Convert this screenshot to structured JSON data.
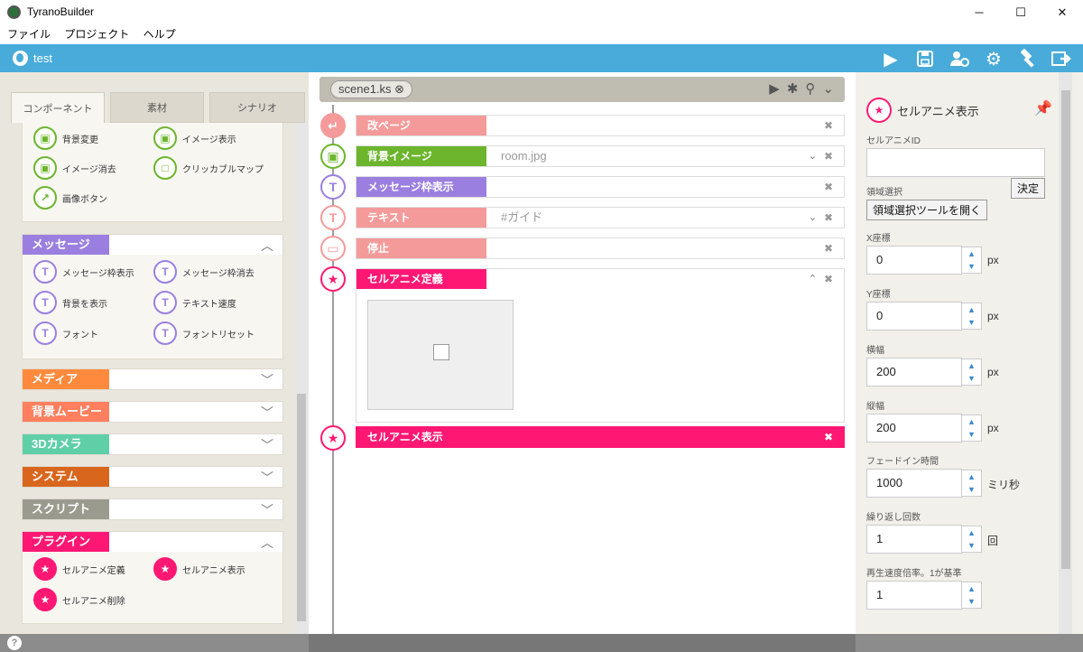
{
  "window": {
    "title": "TyranoBuilder",
    "minimize": "─",
    "maximize": "☐",
    "close": "✕"
  },
  "menu": [
    "ファイル",
    "プロジェクト",
    "ヘルプ"
  ],
  "topbar": {
    "project": "test"
  },
  "left_tabs": [
    "コンポーネント",
    "素材",
    "シナリオ"
  ],
  "image_components": [
    "背景変更",
    "イメージ表示",
    "イメージ消去",
    "クリッカブルマップ",
    "画像ボタン"
  ],
  "categories": {
    "message": "メッセージ",
    "media": "メディア",
    "bgmovie": "背景ムービー",
    "camera": "3Dカメラ",
    "system": "システム",
    "script": "スクリプト",
    "plugin": "プラグイン"
  },
  "colors": {
    "message": "#9b7fe0",
    "media": "#ff8a3d",
    "bgmovie": "#ff7f5f",
    "camera": "#5fcfa8",
    "system": "#d9661d",
    "script": "#9a9a8e",
    "plugin": "#ff1873",
    "green": "#6cb52d",
    "salmon": "#f59a9a"
  },
  "message_components": [
    "メッセージ枠表示",
    "メッセージ枠消去",
    "背景を表示",
    "テキスト速度",
    "フォント",
    "フォントリセット"
  ],
  "plugin_components": [
    "セルアニメ定義",
    "セルアニメ表示",
    "セルアニメ削除"
  ],
  "scene": {
    "tab": "scene1.ks"
  },
  "timeline": [
    {
      "label": "改ページ",
      "value": ""
    },
    {
      "label": "背景イメージ",
      "value": "room.jpg"
    },
    {
      "label": "メッセージ枠表示",
      "value": ""
    },
    {
      "label": "テキスト",
      "value": "#ガイド"
    },
    {
      "label": "停止",
      "value": ""
    },
    {
      "label": "セルアニメ定義",
      "value": ""
    },
    {
      "label": "セルアニメ表示",
      "value": ""
    }
  ],
  "props": {
    "title": "セルアニメ表示",
    "id_label": "セルアニメID",
    "id_value": "",
    "decide": "決定",
    "region_label": "領域選択",
    "region_button": "領域選択ツールを開く",
    "x_label": "X座標",
    "x_value": "0",
    "x_unit": "px",
    "y_label": "Y座標",
    "y_value": "0",
    "y_unit": "px",
    "w_label": "横幅",
    "w_value": "200",
    "w_unit": "px",
    "h_label": "縦幅",
    "h_value": "200",
    "h_unit": "px",
    "fade_label": "フェードイン時間",
    "fade_value": "1000",
    "fade_unit": "ミリ秒",
    "loop_label": "繰り返し回数",
    "loop_value": "1",
    "loop_unit": "回",
    "speed_label": "再生速度倍率。1が基準",
    "speed_value": "1"
  },
  "status": {
    "help": "?"
  }
}
